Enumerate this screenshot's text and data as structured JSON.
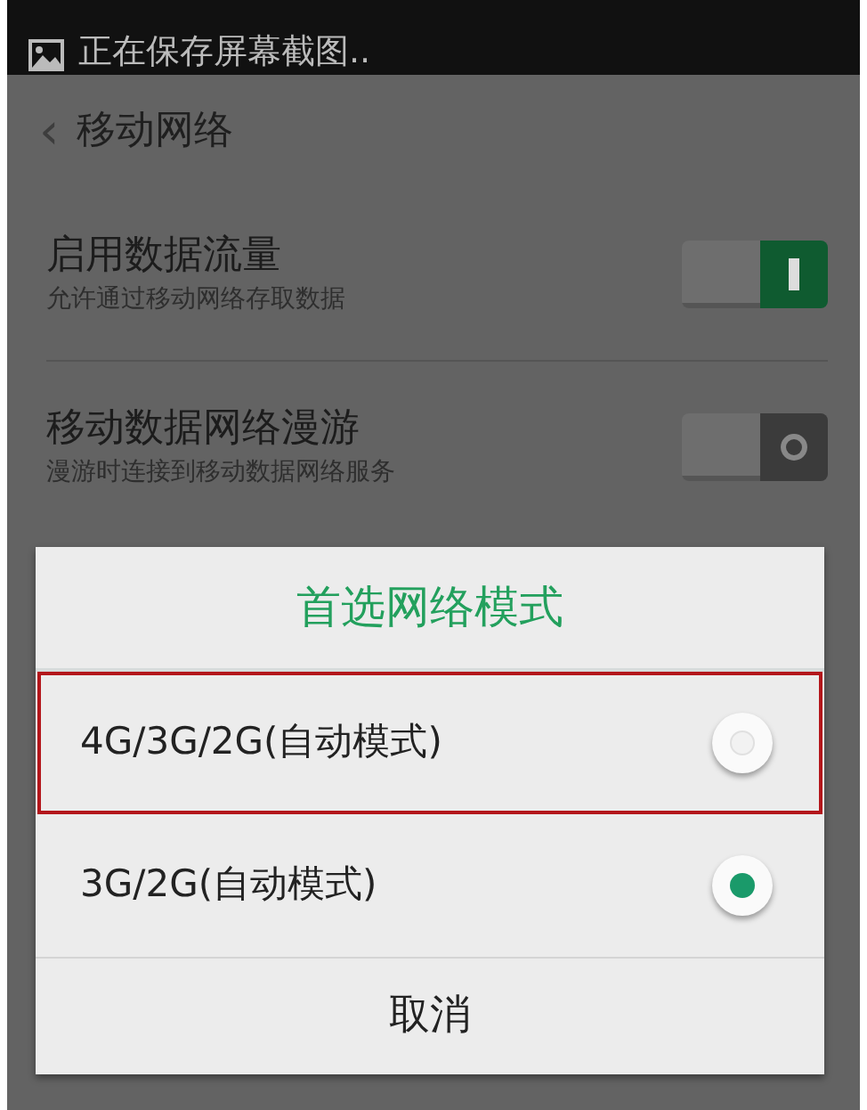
{
  "notification": {
    "text": "正在保存屏幕截图.."
  },
  "header": {
    "back": "‹",
    "title": "移动网络"
  },
  "settings": [
    {
      "title": "启用数据流量",
      "subtitle": "允许通过移动网络存取数据",
      "on": true
    },
    {
      "title": "移动数据网络漫游",
      "subtitle": "漫游时连接到移动数据网络服务",
      "on": false
    }
  ],
  "dialog": {
    "title": "首选网络模式",
    "options": [
      {
        "label": "4G/3G/2G(自动模式)",
        "selected": false,
        "highlighted": true
      },
      {
        "label": "3G/2G(自动模式)",
        "selected": true,
        "highlighted": false
      }
    ],
    "cancel": "取消"
  }
}
